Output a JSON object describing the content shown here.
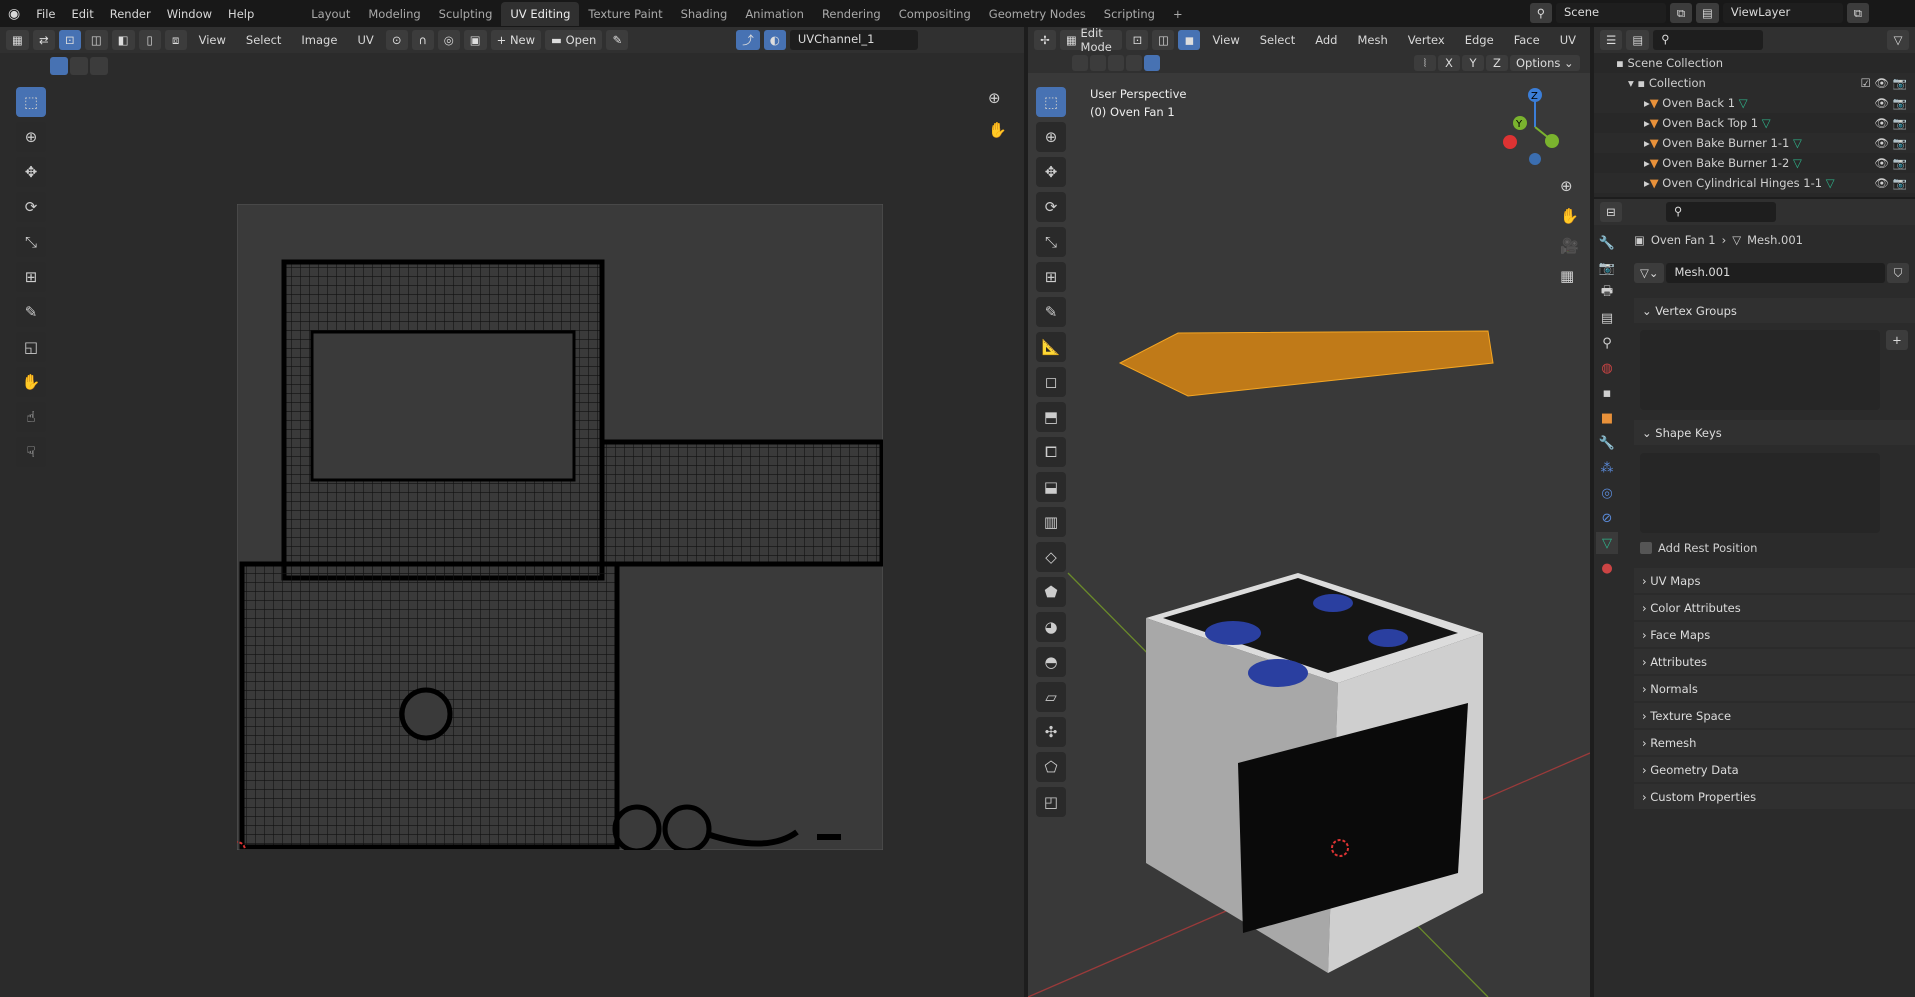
{
  "menu": [
    "File",
    "Edit",
    "Render",
    "Window",
    "Help"
  ],
  "workspaces": [
    "Layout",
    "Modeling",
    "Sculpting",
    "UV Editing",
    "Texture Paint",
    "Shading",
    "Animation",
    "Rendering",
    "Compositing",
    "Geometry Nodes",
    "Scripting"
  ],
  "active_workspace": "UV Editing",
  "scene": "Scene",
  "view_layer": "ViewLayer",
  "uv_header": {
    "menus": [
      "View",
      "Select",
      "Image",
      "UV"
    ],
    "new": "New",
    "open": "Open",
    "uv_channel": "UVChannel_1"
  },
  "viewport_header": {
    "mode": "Edit Mode",
    "menus": [
      "View",
      "Select",
      "Add",
      "Mesh",
      "Vertex",
      "Edge",
      "Face",
      "UV"
    ],
    "axes": [
      "X",
      "Y",
      "Z"
    ],
    "options": "Options"
  },
  "viewport": {
    "perspective": "User Perspective",
    "object": "(0) Oven Fan 1"
  },
  "outliner": {
    "root": "Scene Collection",
    "collection": "Collection",
    "items": [
      "Oven Back 1",
      "Oven Back Top 1",
      "Oven Bake Burner 1-1",
      "Oven Bake Burner 1-2",
      "Oven Cylindrical Hinges 1-1"
    ]
  },
  "properties": {
    "object": "Oven Fan 1",
    "mesh": "Mesh.001",
    "mesh_field": "Mesh.001",
    "vertex_groups": "Vertex Groups",
    "shape_keys": "Shape Keys",
    "add_rest_position": "Add Rest Position",
    "sections": [
      "UV Maps",
      "Color Attributes",
      "Face Maps",
      "Attributes",
      "Normals",
      "Texture Space",
      "Remesh",
      "Geometry Data",
      "Custom Properties"
    ]
  },
  "colors": {
    "accent": "#4772b3",
    "selection": "#f5a623",
    "mesh_icon": "#e8913a",
    "data_icon": "#2fb38a"
  }
}
